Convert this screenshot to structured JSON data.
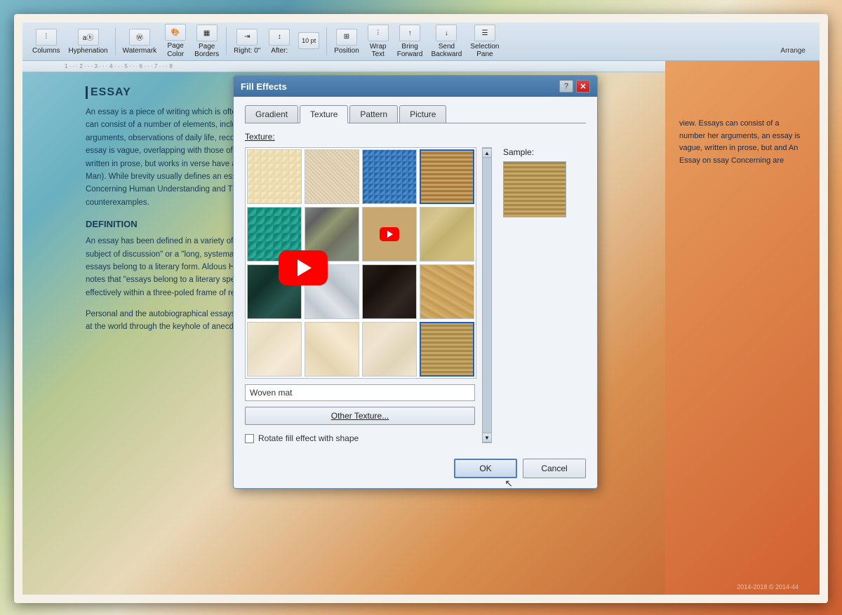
{
  "window": {
    "title": "Fill Effects"
  },
  "toolbar": {
    "items": [
      {
        "label": "Columns"
      },
      {
        "label": "Hyphenation"
      },
      {
        "label": "Watermark"
      },
      {
        "label": "Page\nColor"
      },
      {
        "label": "Page\nBorders"
      },
      {
        "label": "Right: 0\""
      },
      {
        "label": "After:"
      },
      {
        "label": "10 pt"
      },
      {
        "label": "Position"
      },
      {
        "label": "Wrap\nText"
      },
      {
        "label": "Bring\nForward"
      },
      {
        "label": "Send\nBackward"
      },
      {
        "label": "Selection\nPane"
      }
    ],
    "arrange_label": "Arrange"
  },
  "dialog": {
    "title": "Fill Effects",
    "tabs": [
      {
        "label": "Gradient",
        "active": false
      },
      {
        "label": "Texture",
        "active": true
      },
      {
        "label": "Pattern",
        "active": false
      },
      {
        "label": "Picture",
        "active": false
      }
    ],
    "texture_label": "Texture:",
    "selected_texture": "Woven mat",
    "other_texture_btn": "Other Texture...",
    "rotate_label": "Rotate fill effect with shape",
    "sample_label": "Sample:",
    "ok_label": "OK",
    "cancel_label": "Cancel"
  },
  "document": {
    "title": "ESSAY",
    "body1": "An essay is a piece of writing which is often written from an author's personal point of view. Essays can consist of a number of elements, including: literary criticism, political manifestos, learned arguments, observations of daily life, recollections, and reflections of the author. The definition of an essay is vague, overlapping with those of an article and a short story. Almost all modern essays are written in prose, but works in verse have also been called essays (e.g. Alexander Pope's An Essay on Man). While brevity usually defines an essay, voluminous works like John Locke's An Essay Concerning Human Understanding and Thomas Malthus's An Essay on the Principle of Population are counterexamples.",
    "section_title": "DEFINITION",
    "body2": "An essay has been defined in a variety of ways. One definition is a \"prose composition with a focused subject of discussion\" or a \"long, systematic discourse\". It is difficult to define the genre into which essays belong to a literary form. Aldous Huxley, a leading essayist, gives guidance on the subject. He notes that \"essays belong to a literary species whose extreme variability can be studied most effectively within a three-poled frame of reference\". Huxley's three poles are:",
    "body3": "Personal and the autobiographical essays: these use \"fragments of reflective autobiography\" to \"look at the world through the keyhole of anecdote and description\".",
    "right_text": "view. Essays can consist of a number her arguments, an essay is vague, written in prose, but and An Essay on ssay Concerning are"
  },
  "timestamp": "2014-2018 © 2014-44",
  "colors": {
    "dialog_title_bg": "#4878a8",
    "tab_active_bg": "#f0f4f8",
    "ok_border": "#5080b8"
  }
}
